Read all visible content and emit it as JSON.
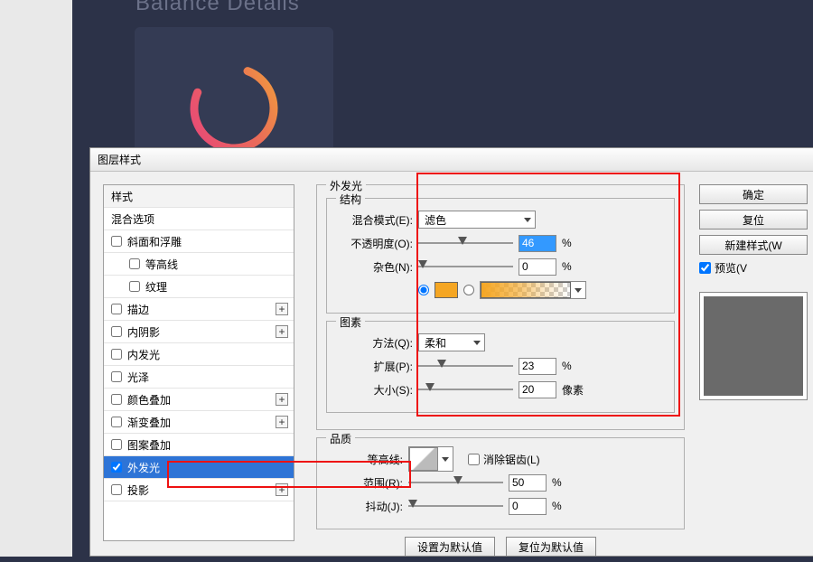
{
  "bg_title": "Balance Details",
  "dialog_title": "图层样式",
  "styles": {
    "header": "样式",
    "blend_options": "混合选项",
    "bevel": "斜面和浮雕",
    "contour": "等高线",
    "texture": "纹理",
    "stroke": "描边",
    "inner_shadow": "内阴影",
    "inner_glow": "内发光",
    "satin": "光泽",
    "color_overlay": "颜色叠加",
    "gradient_overlay": "渐变叠加",
    "pattern_overlay": "图案叠加",
    "outer_glow": "外发光",
    "drop_shadow": "投影"
  },
  "panel": {
    "title": "外发光",
    "structure": {
      "legend": "结构",
      "blend_mode_label": "混合模式(E):",
      "blend_mode_value": "滤色",
      "opacity_label": "不透明度(O):",
      "opacity_value": "46",
      "opacity_unit": "%",
      "noise_label": "杂色(N):",
      "noise_value": "0",
      "noise_unit": "%",
      "swatch_color": "#f5a623"
    },
    "elements": {
      "legend": "图素",
      "technique_label": "方法(Q):",
      "technique_value": "柔和",
      "spread_label": "扩展(P):",
      "spread_value": "23",
      "spread_unit": "%",
      "size_label": "大小(S):",
      "size_value": "20",
      "size_unit": "像素"
    },
    "quality": {
      "legend": "品质",
      "contour_label": "等高线:",
      "antialias_label": "消除锯齿(L)",
      "range_label": "范围(R):",
      "range_value": "50",
      "range_unit": "%",
      "jitter_label": "抖动(J):",
      "jitter_value": "0",
      "jitter_unit": "%"
    },
    "defaults_set": "设置为默认值",
    "defaults_reset": "复位为默认值"
  },
  "buttons": {
    "ok": "确定",
    "cancel": "复位",
    "new_style": "新建样式(W",
    "preview": "预览(V"
  }
}
